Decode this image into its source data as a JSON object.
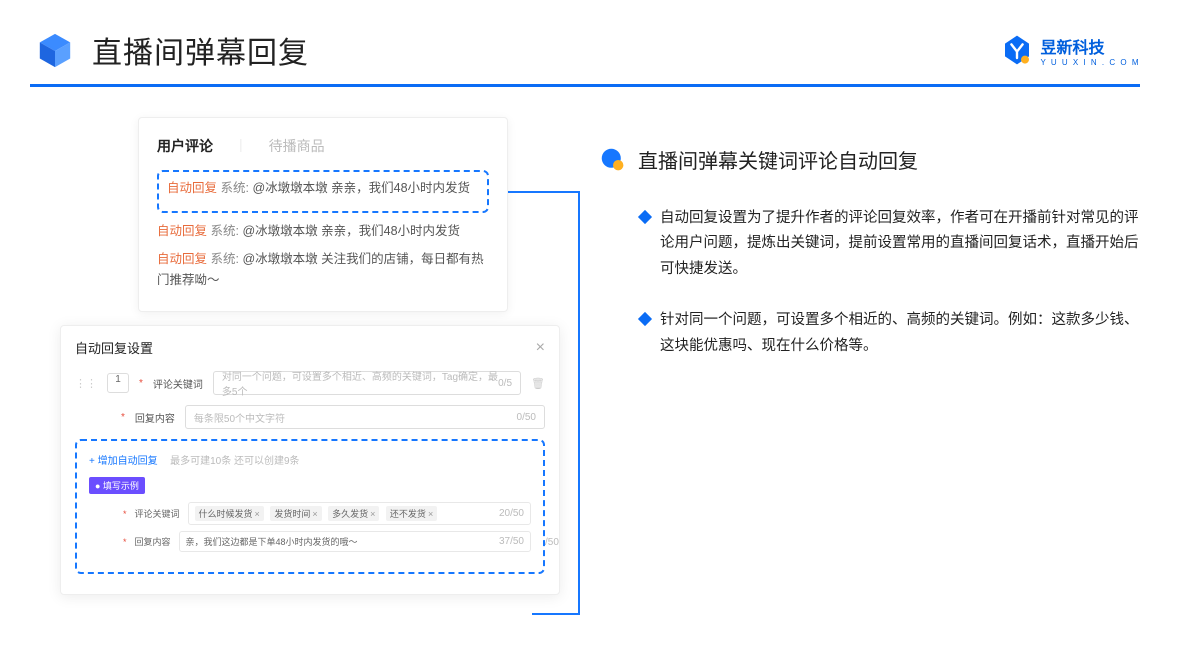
{
  "header": {
    "title": "直播间弹幕回复",
    "brand_cn": "昱新科技",
    "brand_en": "Y U U X I N . C O M"
  },
  "right": {
    "section_title": "直播间弹幕关键词评论自动回复",
    "bullets": [
      "自动回复设置为了提升作者的评论回复效率，作者可在开播前针对常见的评论用户问题，提炼出关键词，提前设置常用的直播间回复话术，直播开始后可快捷发送。",
      "针对同一个问题，可设置多个相近的、高频的关键词。例如：这款多少钱、这块能优惠吗、现在什么价格等。"
    ]
  },
  "comments_card": {
    "tabs": {
      "active": "用户评论",
      "inactive": "待播商品"
    },
    "items": [
      {
        "tag": "自动回复",
        "sys": "系统:",
        "text": "@冰墩墩本墩 亲亲，我们48小时内发货"
      },
      {
        "tag": "自动回复",
        "sys": "系统:",
        "text": "@冰墩墩本墩 亲亲，我们48小时内发货"
      },
      {
        "tag": "自动回复",
        "sys": "系统:",
        "text": "@冰墩墩本墩 关注我们的店铺，每日都有热门推荐呦～"
      }
    ]
  },
  "settings_card": {
    "title": "自动回复设置",
    "index": "1",
    "keyword_label": "评论关键词",
    "keyword_placeholder": "对同一个问题，可设置多个相近、高频的关键词，Tag确定，最多5个",
    "keyword_counter": "0/5",
    "content_label": "回复内容",
    "content_placeholder": "每条限50个中文字符",
    "content_counter": "0/50",
    "add_link": "+ 增加自动回复",
    "add_hint": "最多可建10条 还可以创建9条",
    "example_badge": "● 填写示例",
    "ex_keyword_label": "评论关键词",
    "ex_tags": [
      "什么时候发货",
      "发货时间",
      "多久发货",
      "还不发货"
    ],
    "ex_keyword_counter": "20/50",
    "ex_content_label": "回复内容",
    "ex_content_value": "亲，我们这边都是下单48小时内发货的哦～",
    "ex_content_counter": "37/50",
    "outside_counter": "/50"
  }
}
